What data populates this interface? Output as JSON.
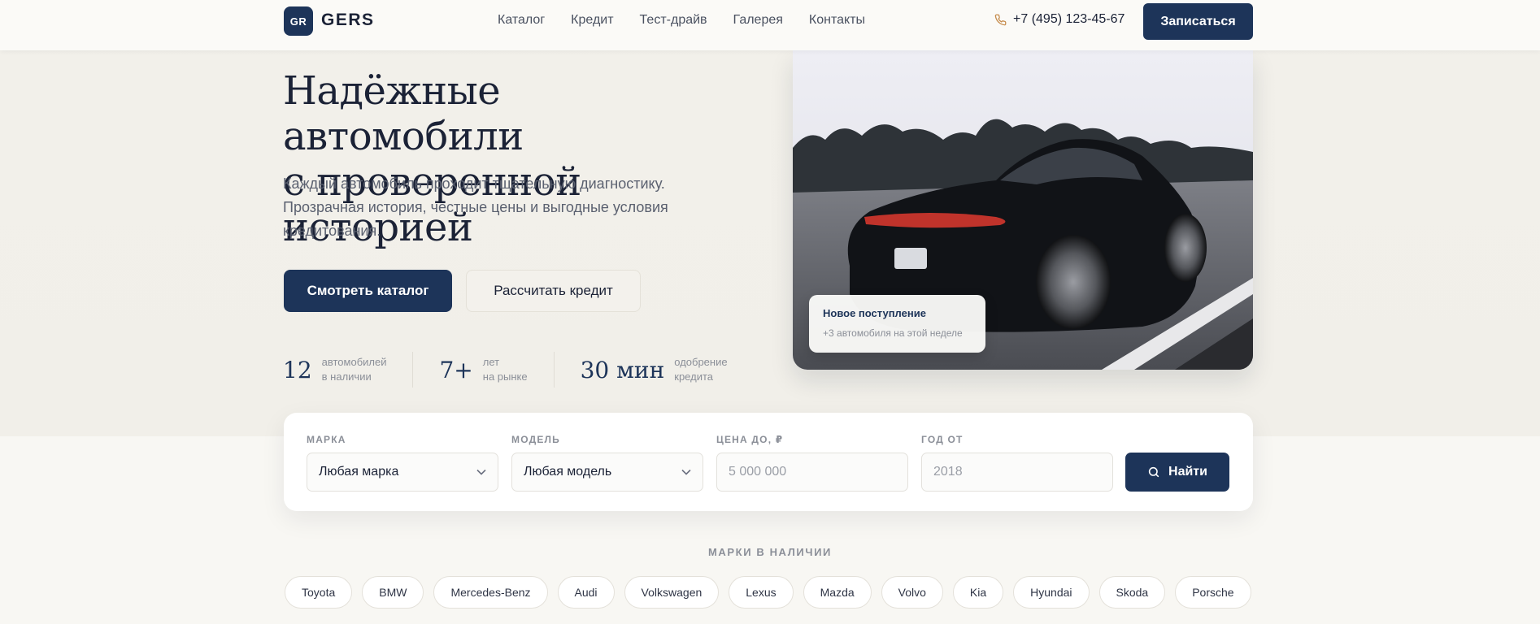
{
  "header": {
    "logo_mark": "GR",
    "logo_text": "GERS",
    "nav": [
      "Каталог",
      "Кредит",
      "Тест-драйв",
      "Галерея",
      "Контакты"
    ],
    "phone": "+7 (495) 123-45-67",
    "cta": "Записаться"
  },
  "hero": {
    "title_line1": "Надёжные автомобили",
    "title_line2": "с проверенной историей",
    "subtitle": "Каждый автомобиль проходит тщательную диагностику. Прозрачная история, честные цены и выгодные условия кредитования.",
    "btn_catalog": "Смотреть каталог",
    "btn_credit": "Рассчитать кредит",
    "stats": [
      {
        "num": "12",
        "label1": "автомобилей",
        "label2": "в наличии"
      },
      {
        "num": "7+",
        "label1": "лет",
        "label2": "на рынке"
      },
      {
        "num": "30 мин",
        "label1": "одобрение",
        "label2": "кредита"
      }
    ],
    "badge_title": "Новое поступление",
    "badge_sub": "+3 автомобиля на этой неделе"
  },
  "search": {
    "brand_label": "МАРКА",
    "brand_value": "Любая марка",
    "model_label": "МОДЕЛЬ",
    "model_value": "Любая модель",
    "price_label": "ЦЕНА ДО, ₽",
    "price_placeholder": "5 000 000",
    "year_label": "ГОД ОТ",
    "year_placeholder": "2018",
    "find": "Найти"
  },
  "brands": {
    "title": "МАРКИ В НАЛИЧИИ",
    "items": [
      "Toyota",
      "BMW",
      "Mercedes-Benz",
      "Audi",
      "Volkswagen",
      "Lexus",
      "Mazda",
      "Volvo",
      "Kia",
      "Hyundai",
      "Skoda",
      "Porsche"
    ]
  },
  "colors": {
    "primary": "#1d3459",
    "background": "#f7f6f2",
    "accent_phone": "#c58a4a"
  }
}
